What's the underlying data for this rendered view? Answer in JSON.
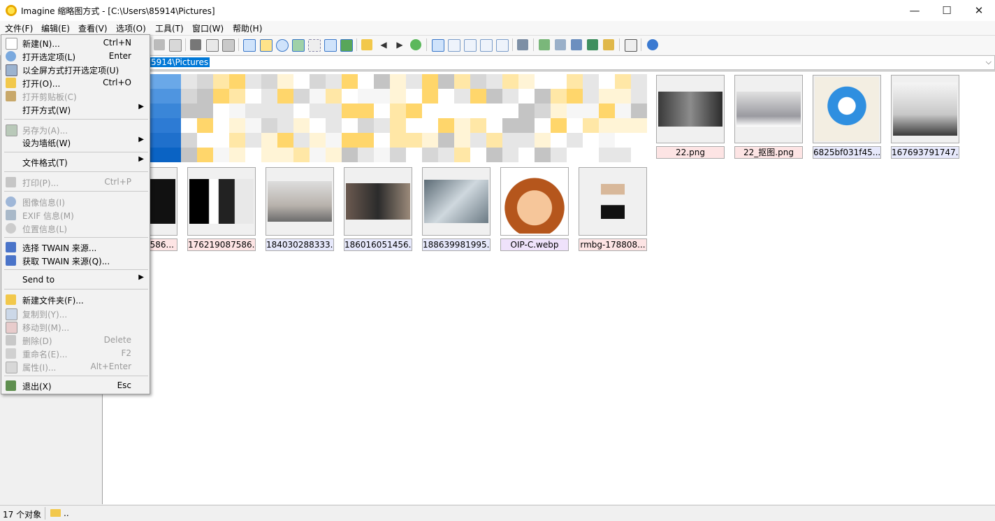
{
  "window": {
    "title": "Imagine 缩略图方式 - [C:\\Users\\85914\\Pictures]",
    "minimize": "—",
    "maximize": "☐",
    "close": "✕"
  },
  "menubar": [
    "文件(F)",
    "编辑(E)",
    "查看(V)",
    "选项(O)",
    "工具(T)",
    "窗口(W)",
    "帮助(H)"
  ],
  "address": {
    "visible_text": "5914\\Pictures",
    "dropdown": "⌵"
  },
  "file_menu": {
    "new": {
      "label": "新建(N)...",
      "shortcut": "Ctrl+N"
    },
    "open_selected": {
      "label": "打开选定项(L)",
      "shortcut": "Enter"
    },
    "open_fullscreen": {
      "label": "以全屏方式打开选定项(U)"
    },
    "open": {
      "label": "打开(O)...",
      "shortcut": "Ctrl+O"
    },
    "open_clipboard": {
      "label": "打开剪贴板(C)"
    },
    "open_with": {
      "label": "打开方式(W)"
    },
    "save_as": {
      "label": "另存为(A)..."
    },
    "set_wallpaper": {
      "label": "设为墙纸(W)"
    },
    "file_format": {
      "label": "文件格式(T)"
    },
    "print": {
      "label": "打印(P)...",
      "shortcut": "Ctrl+P"
    },
    "image_info": {
      "label": "图像信息(I)"
    },
    "exif_info": {
      "label": "EXIF 信息(M)"
    },
    "location_info": {
      "label": "位置信息(L)"
    },
    "select_twain": {
      "label": "选择 TWAIN 来源..."
    },
    "acquire_twain": {
      "label": "获取 TWAIN 来源(Q)..."
    },
    "send_to": {
      "label": "Send to"
    },
    "new_folder": {
      "label": "新建文件夹(F)..."
    },
    "copy_to": {
      "label": "复制到(Y)..."
    },
    "move_to": {
      "label": "移动到(M)..."
    },
    "delete": {
      "label": "删除(D)",
      "shortcut": "Delete"
    },
    "rename": {
      "label": "重命名(E)...",
      "shortcut": "F2"
    },
    "properties": {
      "label": "属性(I)...",
      "shortcut": "Alt+Enter"
    },
    "exit": {
      "label": "退出(X)",
      "shortcut": "Esc"
    },
    "submenu_arrow": "▶"
  },
  "thumbnails_row1": [
    {
      "name": "22.png"
    },
    {
      "name": "22_抠图.png"
    },
    {
      "name": "6825bf031f45..."
    },
    {
      "name": "167693791747..."
    }
  ],
  "thumbnails_row2": [
    {
      "name": "...7586..."
    },
    {
      "name": "176219087586..."
    },
    {
      "name": "184030288333..."
    },
    {
      "name": "186016051456..."
    },
    {
      "name": "188639981995..."
    },
    {
      "name": "OIP-C.webp"
    },
    {
      "name": "rmbg-178808..."
    }
  ],
  "status": {
    "count": "17 个对象",
    "path": ".."
  },
  "colors": {
    "selection_blue": "#0078d7",
    "png_caption": "#fde4e4",
    "jpg_caption": "#e6e8fb",
    "webp_caption": "#efe2fb"
  }
}
